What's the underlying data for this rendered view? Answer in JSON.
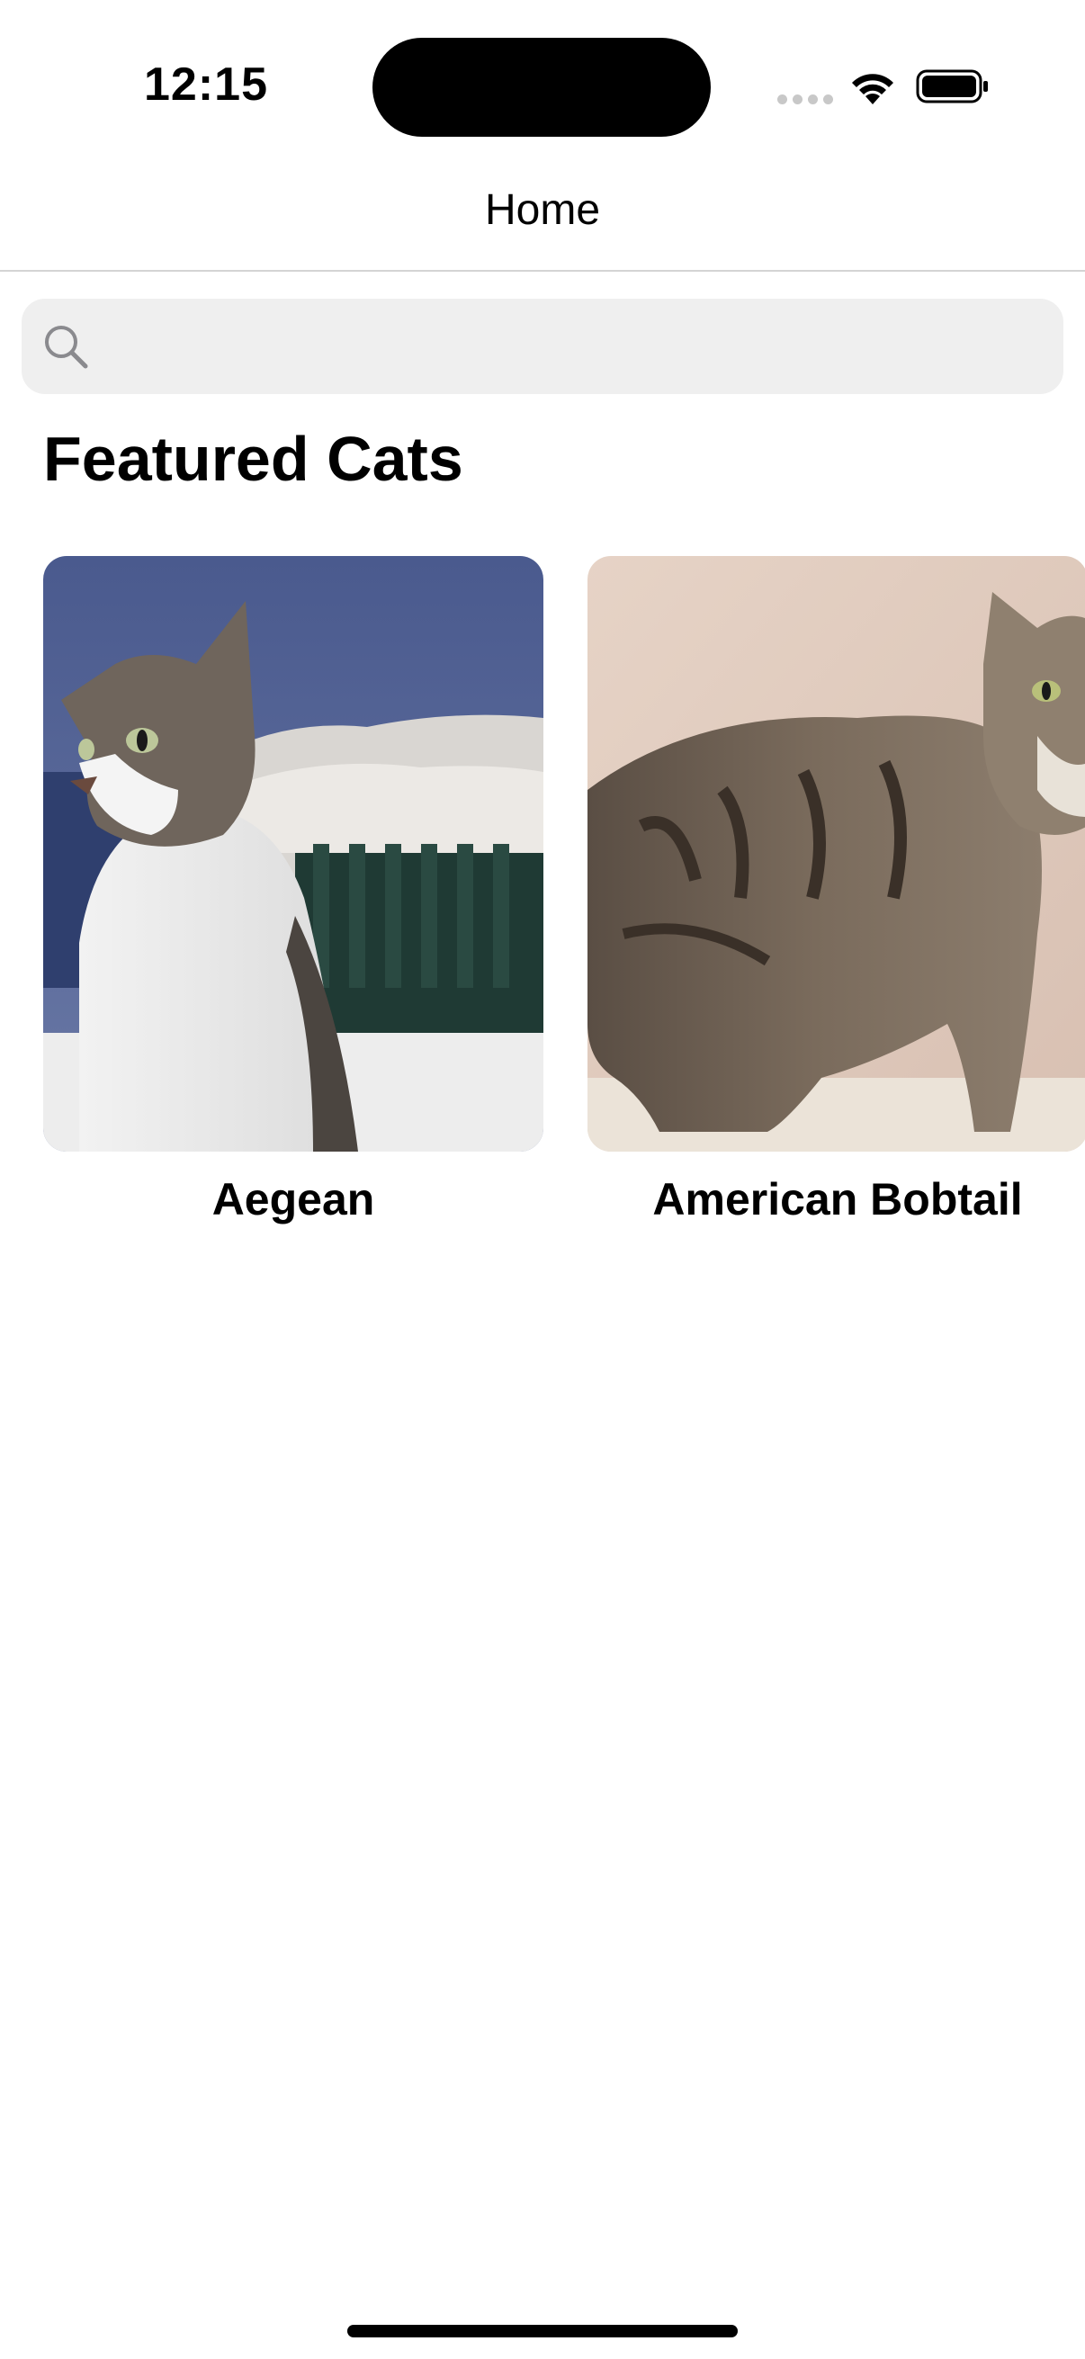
{
  "status_bar": {
    "time": "12:15",
    "icons": [
      "cellular-signal-icon",
      "wifi-icon",
      "battery-icon"
    ]
  },
  "nav": {
    "title": "Home"
  },
  "search": {
    "placeholder": "",
    "value": "",
    "icon": "search-icon"
  },
  "featured": {
    "title": "Featured Cats",
    "cats": [
      {
        "name": "Aegean",
        "image": "tabby-and-white-cat-photo"
      },
      {
        "name": "American Bobtail",
        "image": "brown-tabby-longhair-cat-photo"
      }
    ]
  },
  "colors": {
    "search_background": "#efefef",
    "divider": "#d4d4d4",
    "text": "#000000"
  }
}
